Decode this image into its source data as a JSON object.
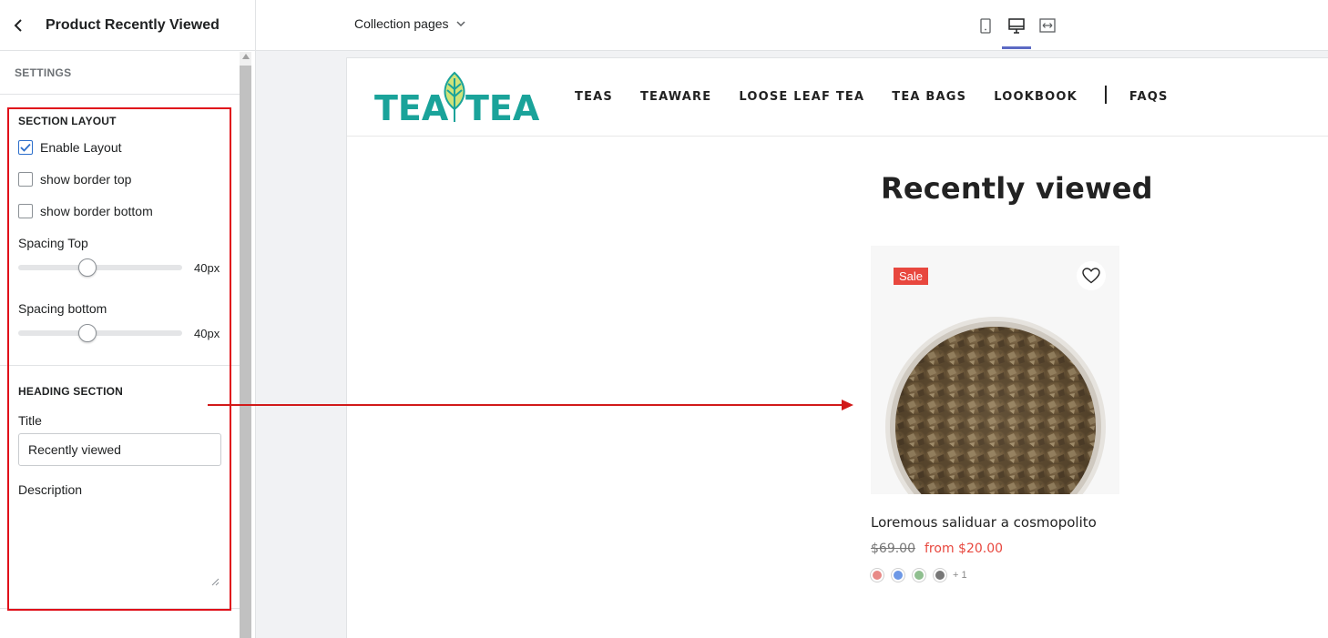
{
  "sidebar": {
    "title": "Product Recently Viewed",
    "settings_label": "SETTINGS",
    "section_layout": {
      "heading": "SECTION LAYOUT",
      "enable_layout": {
        "label": "Enable Layout",
        "checked": true
      },
      "border_top": {
        "label": "show border top",
        "checked": false
      },
      "border_bottom": {
        "label": "show border bottom",
        "checked": false
      },
      "spacing_top": {
        "label": "Spacing Top",
        "value": "40px",
        "fraction": 0.41
      },
      "spacing_bottom": {
        "label": "Spacing bottom",
        "value": "40px",
        "fraction": 0.41
      }
    },
    "heading_section": {
      "heading": "HEADING SECTION",
      "title_label": "Title",
      "title_value": "Recently viewed",
      "description_label": "Description",
      "description_value": ""
    }
  },
  "toolbar": {
    "page_select": "Collection pages",
    "view_icons": [
      "mobile-icon",
      "desktop-icon",
      "fullwidth-icon"
    ],
    "active_view": "desktop-icon"
  },
  "store": {
    "logo_text_left": "TEA",
    "logo_text_right": "TEA",
    "nav": [
      "TEAS",
      "TEAWARE",
      "LOOSE LEAF TEA",
      "TEA BAGS",
      "LOOKBOOK",
      "FAQS"
    ],
    "section_title": "Recently viewed",
    "product": {
      "badge": "Sale",
      "name": "Loremous saliduar a cosmopolito",
      "old_price": "$69.00",
      "new_price": "from $20.00",
      "swatch_colors": [
        "#e88a87",
        "#6d98e6",
        "#8fbf8f",
        "#777777"
      ],
      "more_swatches": "+ 1"
    }
  },
  "colors": {
    "accent": "#5c6ac4",
    "annotation_red": "#e0101a",
    "brand_teal": "#1aa39a",
    "sale_red": "#e8473e"
  }
}
